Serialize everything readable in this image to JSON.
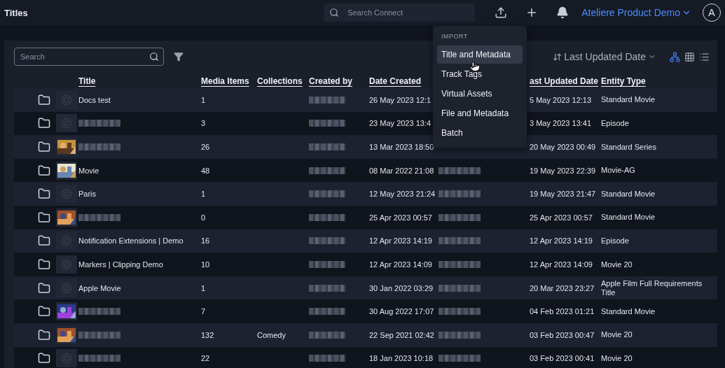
{
  "header": {
    "title": "Titles",
    "search": {
      "placeholder": "Search Connect"
    },
    "account": "Ateliere Product Demo",
    "avatar": "A"
  },
  "toolbar": {
    "search": {
      "placeholder": "Search"
    },
    "sort": {
      "label": "Last Updated Date"
    },
    "views": [
      {
        "kind": "tree",
        "selected": true
      },
      {
        "kind": "grid",
        "selected": false
      },
      {
        "kind": "list",
        "selected": false
      }
    ]
  },
  "table": {
    "columns": [
      "Title",
      "Media Items",
      "Collections",
      "Created by",
      "Date Created",
      null,
      "ast Updated Date",
      "Entity Type"
    ],
    "rows": [
      {
        "thumbnail": {
          "kind": "placeholder"
        },
        "cells": [
          "Docs test",
          "1",
          null,
          {
            "redacted": true
          },
          "26 May 2023 12:1",
          null,
          "5 May 2023 12:13",
          "Standard Movie"
        ]
      },
      {
        "thumbnail": {
          "kind": "placeholder"
        },
        "cells": [
          {
            "redacted": true
          },
          "3",
          null,
          {
            "redacted": true
          },
          "23 May 2023 13:4",
          null,
          "3 May 2023 13:41",
          "Episode"
        ]
      },
      {
        "cells": [
          {
            "redacted": true
          },
          "26",
          null,
          {
            "redacted": true
          },
          "13 Mar 2023 18:50",
          null,
          "20 May 2023 00:49",
          "Standard Series"
        ]
      },
      {
        "cells": [
          "Movie",
          "48",
          null,
          {
            "redacted": true
          },
          "08 Mar 2022 21:08",
          {
            "redacted": true
          },
          "19 May 2023 22:39",
          "Movie-AG"
        ]
      },
      {
        "thumbnail": {
          "kind": "placeholder"
        },
        "cells": [
          "Paris",
          "1",
          null,
          {
            "redacted": true
          },
          "12 May 2023 21:24",
          {
            "redacted": true
          },
          "19 May 2023 21:47",
          "Standard Movie"
        ]
      },
      {
        "cells": [
          {
            "redacted": true
          },
          "0",
          null,
          {
            "redacted": true
          },
          "25 Apr 2023 00:57",
          {
            "redacted": true
          },
          "25 Apr 2023 00:57",
          "Standard Movie"
        ]
      },
      {
        "thumbnail": {
          "kind": "placeholder"
        },
        "cells": [
          "Notification Extensions | Demo",
          "16",
          null,
          {
            "redacted": true
          },
          "12 Apr 2023 14:19",
          {
            "redacted": true
          },
          "12 Apr 2023 14:19",
          "Episode"
        ]
      },
      {
        "thumbnail": {
          "kind": "placeholder"
        },
        "cells": [
          "Markers | Clipping Demo",
          "10",
          null,
          {
            "redacted": true
          },
          "12 Apr 2023 14:09",
          {
            "redacted": true
          },
          "12 Apr 2023 14:09",
          "Movie 20"
        ]
      },
      {
        "thumbnail": {
          "kind": "placeholder"
        },
        "cells": [
          "Apple Movie",
          "1",
          null,
          {
            "redacted": true
          },
          "30 Jan 2022 03:29",
          {
            "redacted": true
          },
          "20 Mar 2023 23:27",
          "Apple Film Full Requirements Title"
        ]
      },
      {
        "cells": [
          {
            "redacted": true
          },
          "7",
          null,
          {
            "redacted": true
          },
          "30 Aug 2022 17:07",
          {
            "redacted": true
          },
          "04 Feb 2023 01:21",
          "Standard Movie"
        ]
      },
      {
        "cells": [
          {
            "redacted": true
          },
          "132",
          "Comedy",
          {
            "redacted": true
          },
          "22 Sep 2021 02:42",
          {
            "redacted": true
          },
          "03 Feb 2023 00:47",
          "Movie 20"
        ]
      },
      {
        "thumbnail": {
          "kind": "placeholder"
        },
        "cells": [
          {
            "redacted": true
          },
          "22",
          null,
          {
            "redacted": true
          },
          "18 Jan 2023 10:18",
          {
            "redacted": true
          },
          "03 Feb 2023 00:41",
          "Movie 20"
        ]
      }
    ]
  },
  "menu": {
    "heading": "IMPORT",
    "items": [
      {
        "label": "Title and Metadata",
        "selected": true
      },
      {
        "label": "Track Tags",
        "selected": false
      },
      {
        "label": "Virtual Assets",
        "selected": false
      },
      {
        "label": "File and Metadata",
        "selected": false
      },
      {
        "label": "Batch",
        "selected": false
      }
    ]
  }
}
